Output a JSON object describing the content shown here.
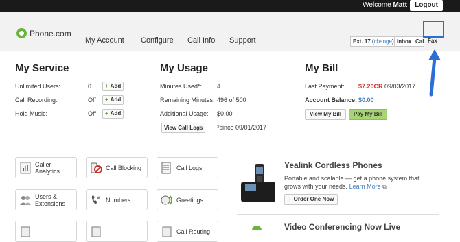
{
  "topbar": {
    "welcome_prefix": "Welcome",
    "user": "Matt",
    "logout_label": "Logout"
  },
  "header": {
    "logo_text": "Phone.com",
    "nav": [
      "My Account",
      "Configure",
      "Call Info",
      "Support"
    ],
    "ext_label": "Ext. 17",
    "ext_link": "change",
    "tabs": [
      "Inbox",
      "Cal",
      "Fax"
    ]
  },
  "my_service": {
    "title": "My Service",
    "rows": [
      {
        "label": "Unlimited Users:",
        "value": "0",
        "button": "Add"
      },
      {
        "label": "Call Recording:",
        "value": "Off",
        "button": "Add"
      },
      {
        "label": "Hold Music:",
        "value": "Off",
        "button": "Add"
      }
    ]
  },
  "my_usage": {
    "title": "My Usage",
    "minutes_used_label": "Minutes Used*:",
    "minutes_used_value": "4",
    "remaining_label": "Remaining Minutes:",
    "remaining_value": "496 of 500",
    "additional_label": "Additional Usage:",
    "additional_value": "$0.00",
    "view_logs_label": "View Call Logs",
    "since_note": "*since 09/01/2017"
  },
  "my_bill": {
    "title": "My Bill",
    "last_payment_label": "Last Payment:",
    "last_payment_amount": "$7.20CR",
    "last_payment_date": "09/03/2017",
    "balance_label": "Account Balance:",
    "balance_value": "$0.00",
    "view_bill_label": "View My Bill",
    "pay_bill_label": "Pay My Bill"
  },
  "tiles": [
    {
      "label": "Caller Analytics",
      "icon": "analytics-icon"
    },
    {
      "label": "Call Blocking",
      "icon": "call-blocking-icon"
    },
    {
      "label": "Call Logs",
      "icon": "call-logs-icon"
    },
    {
      "label": "Users & Extensions",
      "icon": "users-icon"
    },
    {
      "label": "Numbers",
      "icon": "numbers-icon"
    },
    {
      "label": "Greetings",
      "icon": "greetings-icon"
    },
    {
      "label": "",
      "icon": "tile-icon"
    },
    {
      "label": "",
      "icon": "tile-icon"
    },
    {
      "label": "Call Routing",
      "icon": "call-routing-icon"
    }
  ],
  "promo": {
    "title": "Yealink Cordless Phones",
    "text": "Portable and scalable — get a phone system that grows with your needs.",
    "learn_more": "Learn More",
    "order_label": "Order One Now",
    "next_title": "Video Conferencing Now Live"
  },
  "colors": {
    "accent_blue": "#3b7dc4",
    "credit_red": "#d0312d",
    "pay_green": "#a7d572",
    "logo_green": "#6bb43a",
    "highlight": "#2b6fd6"
  }
}
